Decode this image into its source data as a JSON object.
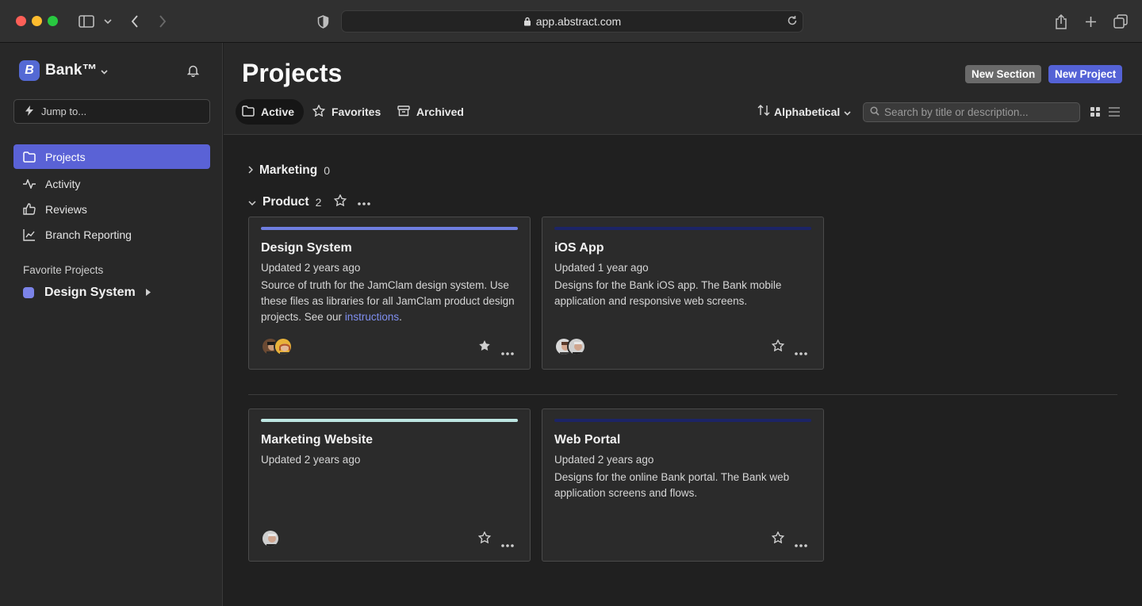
{
  "browser": {
    "url": "app.abstract.com"
  },
  "sidebar": {
    "workspace_name": "Bank™",
    "workspace_initial": "B",
    "jump_placeholder": "Jump to...",
    "nav": [
      {
        "label": "Projects",
        "icon": "folder-icon",
        "active": true
      },
      {
        "label": "Activity",
        "icon": "activity-icon",
        "active": false
      },
      {
        "label": "Reviews",
        "icon": "thumbs-up-icon",
        "active": false
      },
      {
        "label": "Branch Reporting",
        "icon": "chart-icon",
        "active": false
      }
    ],
    "favorites_heading": "Favorite Projects",
    "favorites": [
      {
        "label": "Design System",
        "color": "#7b83e8"
      }
    ]
  },
  "main": {
    "title": "Projects",
    "new_section_label": "New Section",
    "new_project_label": "New Project",
    "tabs": [
      {
        "label": "Active",
        "icon": "folder-icon",
        "active": true
      },
      {
        "label": "Favorites",
        "icon": "star-icon",
        "active": false
      },
      {
        "label": "Archived",
        "icon": "archive-icon",
        "active": false
      }
    ],
    "sort_label": "Alphabetical",
    "search_placeholder": "Search by title or description...",
    "sections": [
      {
        "name": "Marketing",
        "count": "0",
        "expanded": false
      },
      {
        "name": "Product",
        "count": "2",
        "expanded": true
      }
    ],
    "cards": [
      {
        "title": "Design System",
        "updated": "Updated 2 years ago",
        "description": "Source of truth for the JamClam design system. Use these files as libraries for all JamClam product design projects. See our ",
        "link": "instructions",
        "description_end": ".",
        "bar_color": "#6f7ee0",
        "starred": true
      },
      {
        "title": "iOS App",
        "updated": "Updated 1 year ago",
        "description": "Designs for the Bank iOS app. The Bank mobile application and responsive web screens.",
        "bar_color": "#1c2466",
        "starred": false
      },
      {
        "title": "Marketing Website",
        "updated": "Updated 2 years ago",
        "description": "",
        "bar_color": "#bde6e2",
        "starred": false
      },
      {
        "title": "Web Portal",
        "updated": "Updated 2 years ago",
        "description": "Designs for the online Bank portal. The Bank web application screens and flows.",
        "bar_color": "#1c2466",
        "starred": false
      }
    ]
  }
}
